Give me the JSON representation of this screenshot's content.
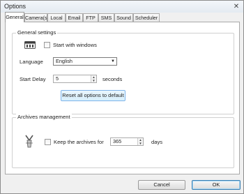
{
  "window": {
    "title": "Options",
    "close_glyph": "✕"
  },
  "tabs": [
    {
      "label": "General",
      "active": true
    },
    {
      "label": "Camera(s)"
    },
    {
      "label": "Local"
    },
    {
      "label": "Email"
    },
    {
      "label": "FTP"
    },
    {
      "label": "SMS"
    },
    {
      "label": "Sound"
    },
    {
      "label": "Scheduler"
    }
  ],
  "general_settings": {
    "group_label": "General settings",
    "app_icon": "application-icon",
    "start_with_windows_label": "Start with windows",
    "start_with_windows_checked": false,
    "language_label": "Language",
    "language_value": "English",
    "start_delay_label": "Start Delay",
    "start_delay_value": "5",
    "start_delay_unit": "seconds",
    "reset_button": "Reset all options to default"
  },
  "archives": {
    "group_label": "Archives management",
    "icon": "archive-icon",
    "keep_label": "Keep the archives for",
    "keep_checked": false,
    "days_value": "365",
    "days_unit": "days"
  },
  "footer": {
    "cancel": "Cancel",
    "ok": "OK"
  }
}
